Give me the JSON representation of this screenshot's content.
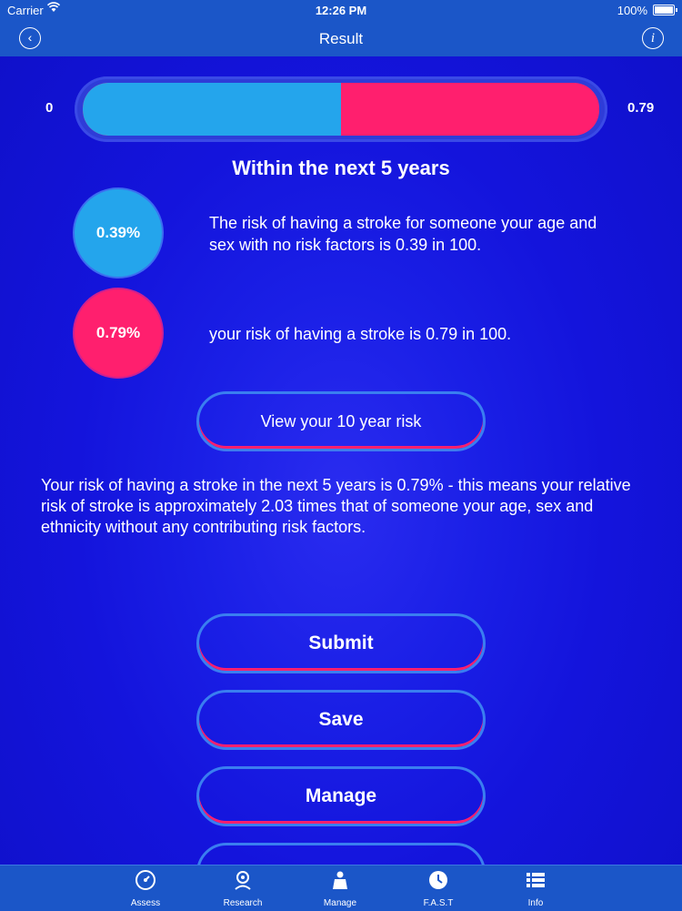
{
  "status_bar": {
    "carrier": "Carrier",
    "wifi_icon": "wifi-icon",
    "time": "12:26 PM",
    "battery": "100%"
  },
  "nav": {
    "title": "Result",
    "back_icon": "back-chevron-icon",
    "info_icon": "info-icon"
  },
  "risk_bar": {
    "min_label": "0",
    "max_label": "0.79",
    "baseline_fraction": 0.5,
    "colors": {
      "baseline": "#24a5ec",
      "user": "#ff1f6e"
    }
  },
  "heading": "Within the next 5 years",
  "baseline": {
    "value": "0.39%",
    "text": "The risk of having a stroke for someone your age and sex with no risk factors is 0.39 in 100."
  },
  "user": {
    "value": "0.79%",
    "text": "your risk of having a stroke is 0.79 in 100."
  },
  "ten_year_button": "View your 10 year risk",
  "summary": "Your risk of having a stroke in the next 5 years is 0.79% - this means your relative risk of stroke is approximately 2.03 times that of someone your age, sex and ethnicity without any contributing risk factors.",
  "actions": {
    "submit": "Submit",
    "save": "Save",
    "manage": "Manage"
  },
  "tabs": [
    {
      "label": "Assess",
      "icon": "gauge-icon"
    },
    {
      "label": "Research",
      "icon": "research-icon"
    },
    {
      "label": "Manage",
      "icon": "manage-icon"
    },
    {
      "label": "F.A.S.T",
      "icon": "clock-icon"
    },
    {
      "label": "Info",
      "icon": "list-icon"
    }
  ]
}
